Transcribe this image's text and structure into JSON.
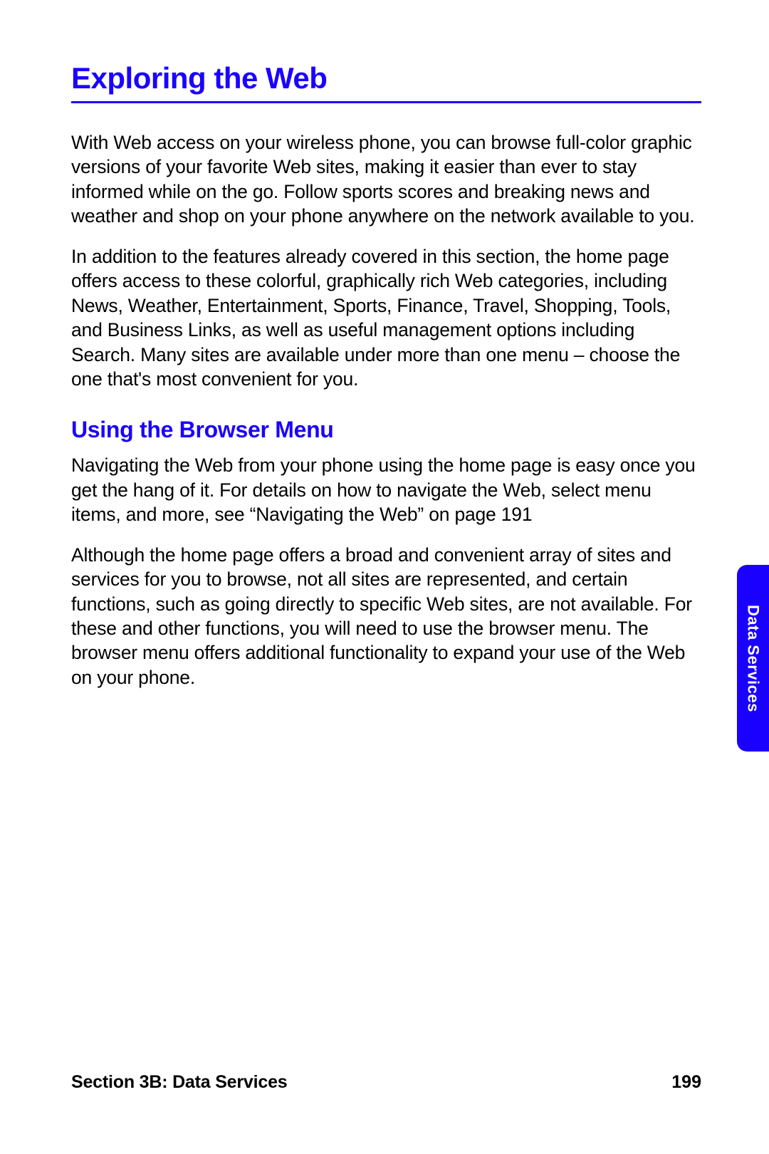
{
  "heading": "Exploring the Web",
  "paragraphs": {
    "p1": "With Web access on your wireless phone, you can browse full-color graphic versions of your favorite Web sites, making it easier than ever to stay informed while on the go. Follow sports scores and breaking news and weather and shop on your phone anywhere on the network available to you.",
    "p2": "In addition to the features already covered in this section, the home page offers access to these colorful, graphically rich Web categories, including News, Weather, Entertainment, Sports, Finance, Travel, Shopping, Tools, and Business Links, as well as useful management options including Search. Many sites are available under more than one menu – choose the one that's most convenient for you."
  },
  "subheading": "Using the Browser Menu",
  "subparagraphs": {
    "p1": "Navigating the Web from your phone using the home page is easy once you get the hang of it. For details on how to navigate the Web, select menu items, and more, see “Navigating the Web” on page 191",
    "p2": "Although the home page offers a broad and convenient array of sites and services for you to browse, not all sites are represented, and certain functions, such as going directly to specific Web sites, are not available. For these and other functions, you will need to use the browser menu. The browser menu offers additional functionality to expand your use of the Web on your phone."
  },
  "sidetab": "Data Services",
  "footer": {
    "section": "Section 3B: Data Services",
    "page": "199"
  }
}
